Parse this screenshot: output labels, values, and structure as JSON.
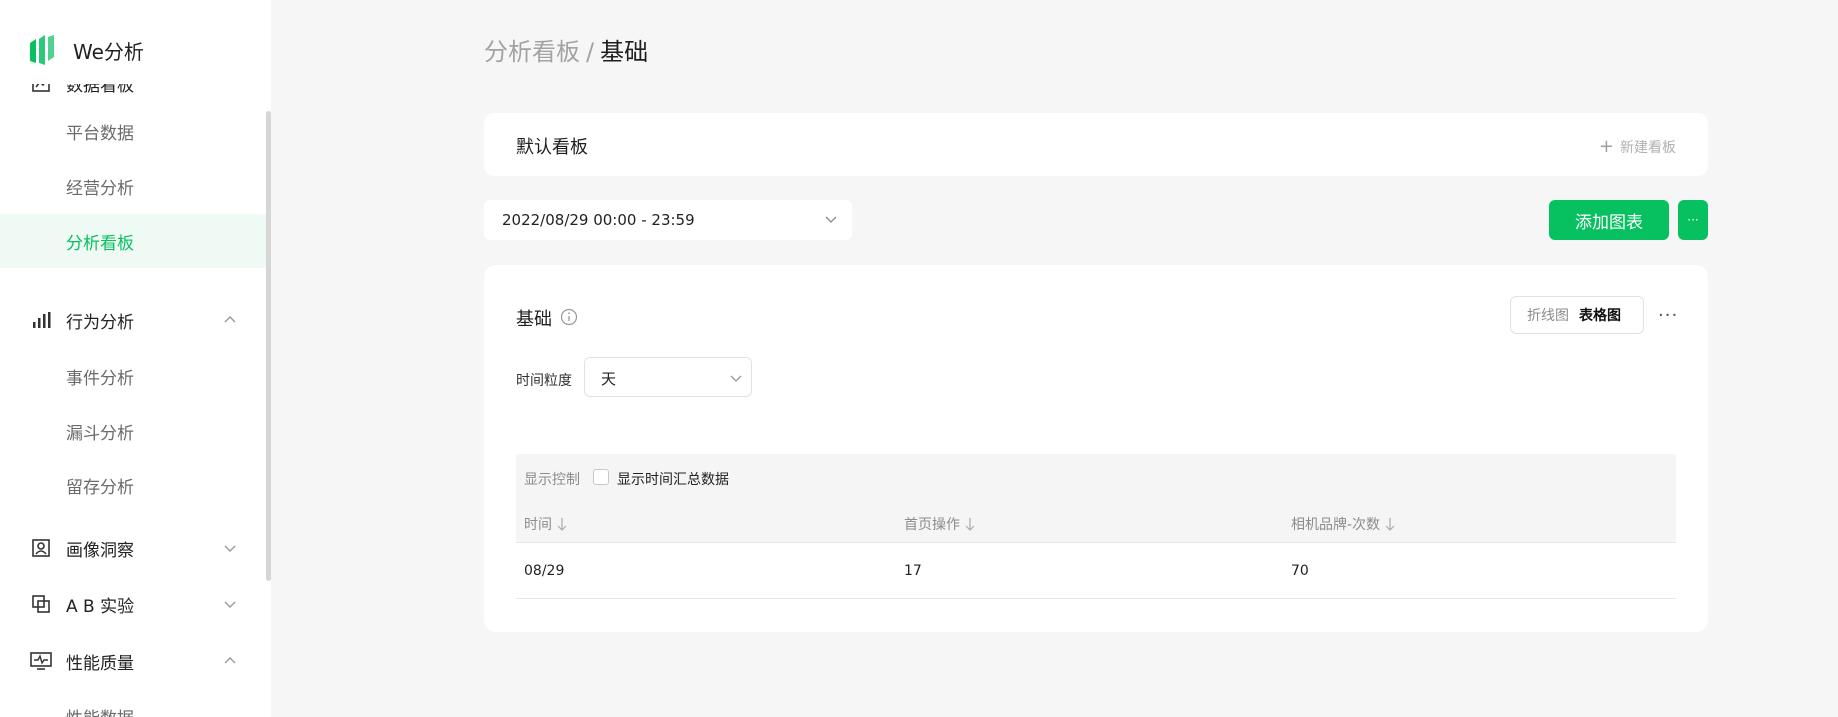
{
  "app": {
    "name": "We分析"
  },
  "sidebar": {
    "groups": [
      {
        "label": "数据看板",
        "icon": "dashboard-icon",
        "expanded": true,
        "children": [
          {
            "label": "平台数据"
          },
          {
            "label": "经营分析"
          },
          {
            "label": "分析看板",
            "active": true
          }
        ]
      },
      {
        "label": "行为分析",
        "icon": "bar-chart-icon",
        "expanded": true,
        "children": [
          {
            "label": "事件分析"
          },
          {
            "label": "漏斗分析"
          },
          {
            "label": "留存分析"
          }
        ]
      },
      {
        "label": "画像洞察",
        "icon": "portrait-icon",
        "expanded": false
      },
      {
        "label": "A B 实验",
        "icon": "ab-test-icon",
        "expanded": false
      },
      {
        "label": "性能质量",
        "icon": "monitor-icon",
        "expanded": true,
        "children": [
          {
            "label": "性能数据"
          }
        ]
      }
    ]
  },
  "breadcrumb": {
    "parent": "分析看板",
    "separator": "/",
    "current": "基础"
  },
  "board": {
    "name": "默认看板",
    "new_label": "新建看板"
  },
  "toolbar": {
    "date_range": "2022/08/29 00:00 - 23:59",
    "add_chart_label": "添加图表",
    "more_label": "···"
  },
  "chart_card": {
    "title": "基础",
    "view_options": [
      "折线图",
      "表格图"
    ],
    "selected_view": "表格图",
    "more_label": "···",
    "granularity_label": "时间粒度",
    "granularity_value": "天",
    "display_control_label": "显示控制",
    "summary_checkbox_label": "显示时间汇总数据",
    "summary_checked": false
  },
  "table": {
    "columns": [
      "时间",
      "首页操作",
      "相机品牌-次数"
    ],
    "rows": [
      [
        "08/29",
        "17",
        "70"
      ]
    ]
  },
  "colors": {
    "accent": "#07c160",
    "background": "#f6f6f6"
  }
}
